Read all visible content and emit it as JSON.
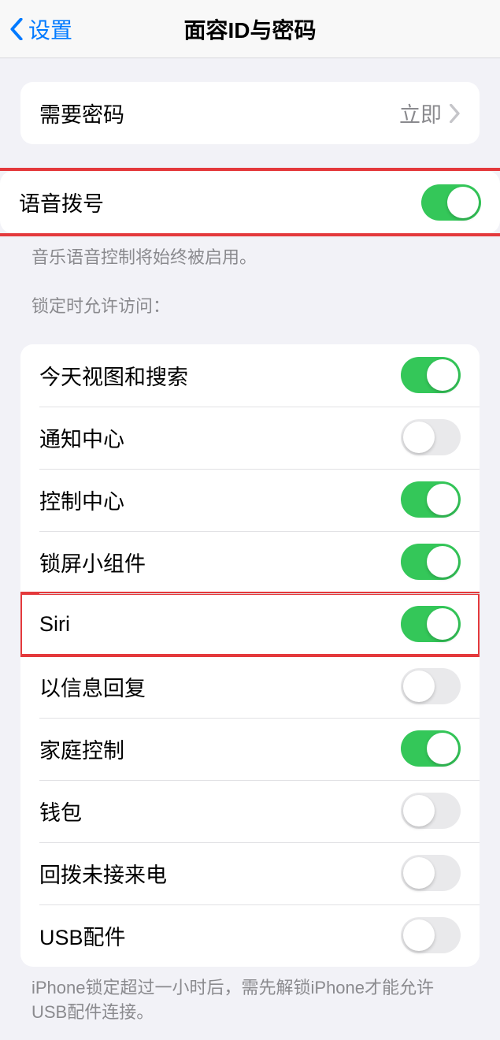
{
  "nav": {
    "back_label": "设置",
    "title": "面容ID与密码"
  },
  "require_passcode": {
    "label": "需要密码",
    "value": "立即"
  },
  "voice_dial": {
    "label": "语音拨号",
    "on": true,
    "footer": "音乐语音控制将始终被启用。"
  },
  "locked_access": {
    "header": "锁定时允许访问：",
    "items": [
      {
        "label": "今天视图和搜索",
        "on": true
      },
      {
        "label": "通知中心",
        "on": false
      },
      {
        "label": "控制中心",
        "on": true
      },
      {
        "label": "锁屏小组件",
        "on": true
      },
      {
        "label": "Siri",
        "on": true
      },
      {
        "label": "以信息回复",
        "on": false
      },
      {
        "label": "家庭控制",
        "on": true
      },
      {
        "label": "钱包",
        "on": false
      },
      {
        "label": "回拨未接来电",
        "on": false
      },
      {
        "label": "USB配件",
        "on": false
      }
    ],
    "footer": "iPhone锁定超过一小时后，需先解锁iPhone才能允许USB配件连接。"
  },
  "highlight_indices": [
    4
  ]
}
